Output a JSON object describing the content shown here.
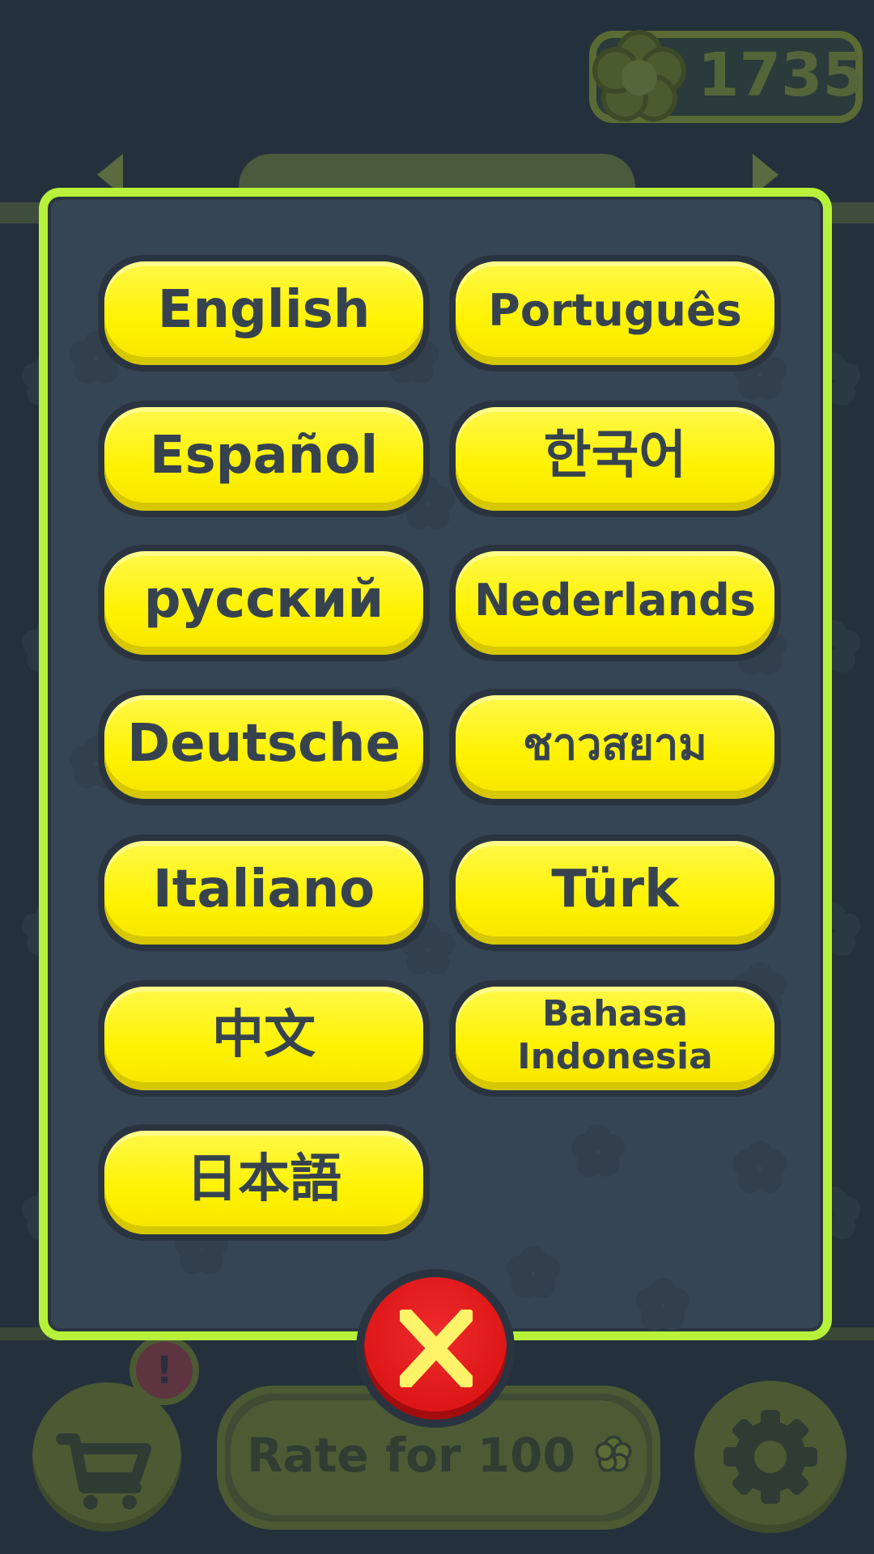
{
  "hud": {
    "coins": "1735",
    "coin_icon": "flower-coin-icon"
  },
  "background": {
    "rate_label": "Rate for 100",
    "rate_icon": "flower-coin-icon",
    "shop_icon": "shopping-cart-icon",
    "shop_alert": "!",
    "settings_icon": "gear-icon"
  },
  "dialog": {
    "languages": [
      "English",
      "Português",
      "Español",
      "한국어",
      "русский",
      "Nederlands",
      "Deutsche",
      "ชาวสยาม",
      "Italiano",
      "Türk",
      "中文",
      "Bahasa Indonesia",
      "日本語"
    ],
    "close_icon": "close-icon"
  },
  "colors": {
    "dialog_border": "#b6f23a",
    "dialog_bg": "#364553",
    "button_yellow": "#fff200",
    "button_text": "#36434f",
    "close_red": "#dc1616",
    "close_x": "#fff36a"
  }
}
